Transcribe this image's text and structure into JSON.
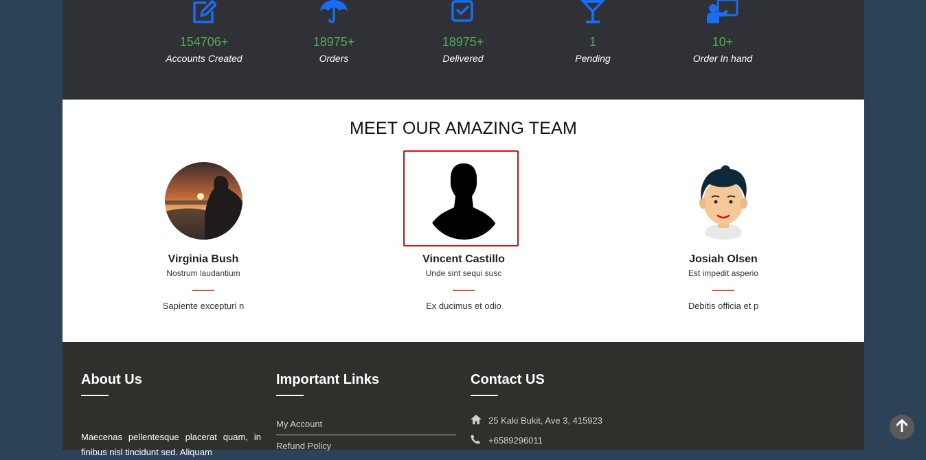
{
  "stats": [
    {
      "icon": "edit-icon",
      "value": "154706+",
      "label": "Accounts Created"
    },
    {
      "icon": "umbrella-icon",
      "value": "18975+",
      "label": "Orders"
    },
    {
      "icon": "checkbox-icon",
      "value": "18975+",
      "label": "Delivered"
    },
    {
      "icon": "cocktail-glass-icon",
      "value": "1",
      "label": "Pending"
    },
    {
      "icon": "presenter-icon",
      "value": "10+",
      "label": "Order In hand"
    }
  ],
  "stat_colors": {
    "icon": "#1a6df2",
    "value": "#4caf50"
  },
  "team": {
    "title": "MEET OUR AMAZING TEAM",
    "members": [
      {
        "name": "Virginia Bush",
        "role": "Nostrum laudantium",
        "desc": "Sapiente excepturi n",
        "avatar": "sunset-silhouette-photo"
      },
      {
        "name": "Vincent Castillo",
        "role": "Unde sint sequi susc",
        "desc": "Ex ducimus et odio",
        "avatar": "default-person-silhouette"
      },
      {
        "name": "Josiah Olsen",
        "role": "Est impedit asperio",
        "desc": "Debitis officia et p",
        "avatar": "cartoon-man-avatar"
      }
    ],
    "divider_color": "#e0522d",
    "selection_color": "#e01010"
  },
  "footer": {
    "about": {
      "heading": "About Us",
      "text": "Maecenas pellentesque placerat quam, in finibus nisl tincidunt sed. Aliquam"
    },
    "links": {
      "heading": "Important Links",
      "items": [
        "My Account",
        "Refund Policy"
      ]
    },
    "contact": {
      "heading": "Contact US",
      "address": "25 Kaki Bukit, Ave 3, 415923",
      "phone": "+6589296011"
    }
  },
  "scroll_top": {
    "icon": "arrow-up-icon"
  }
}
